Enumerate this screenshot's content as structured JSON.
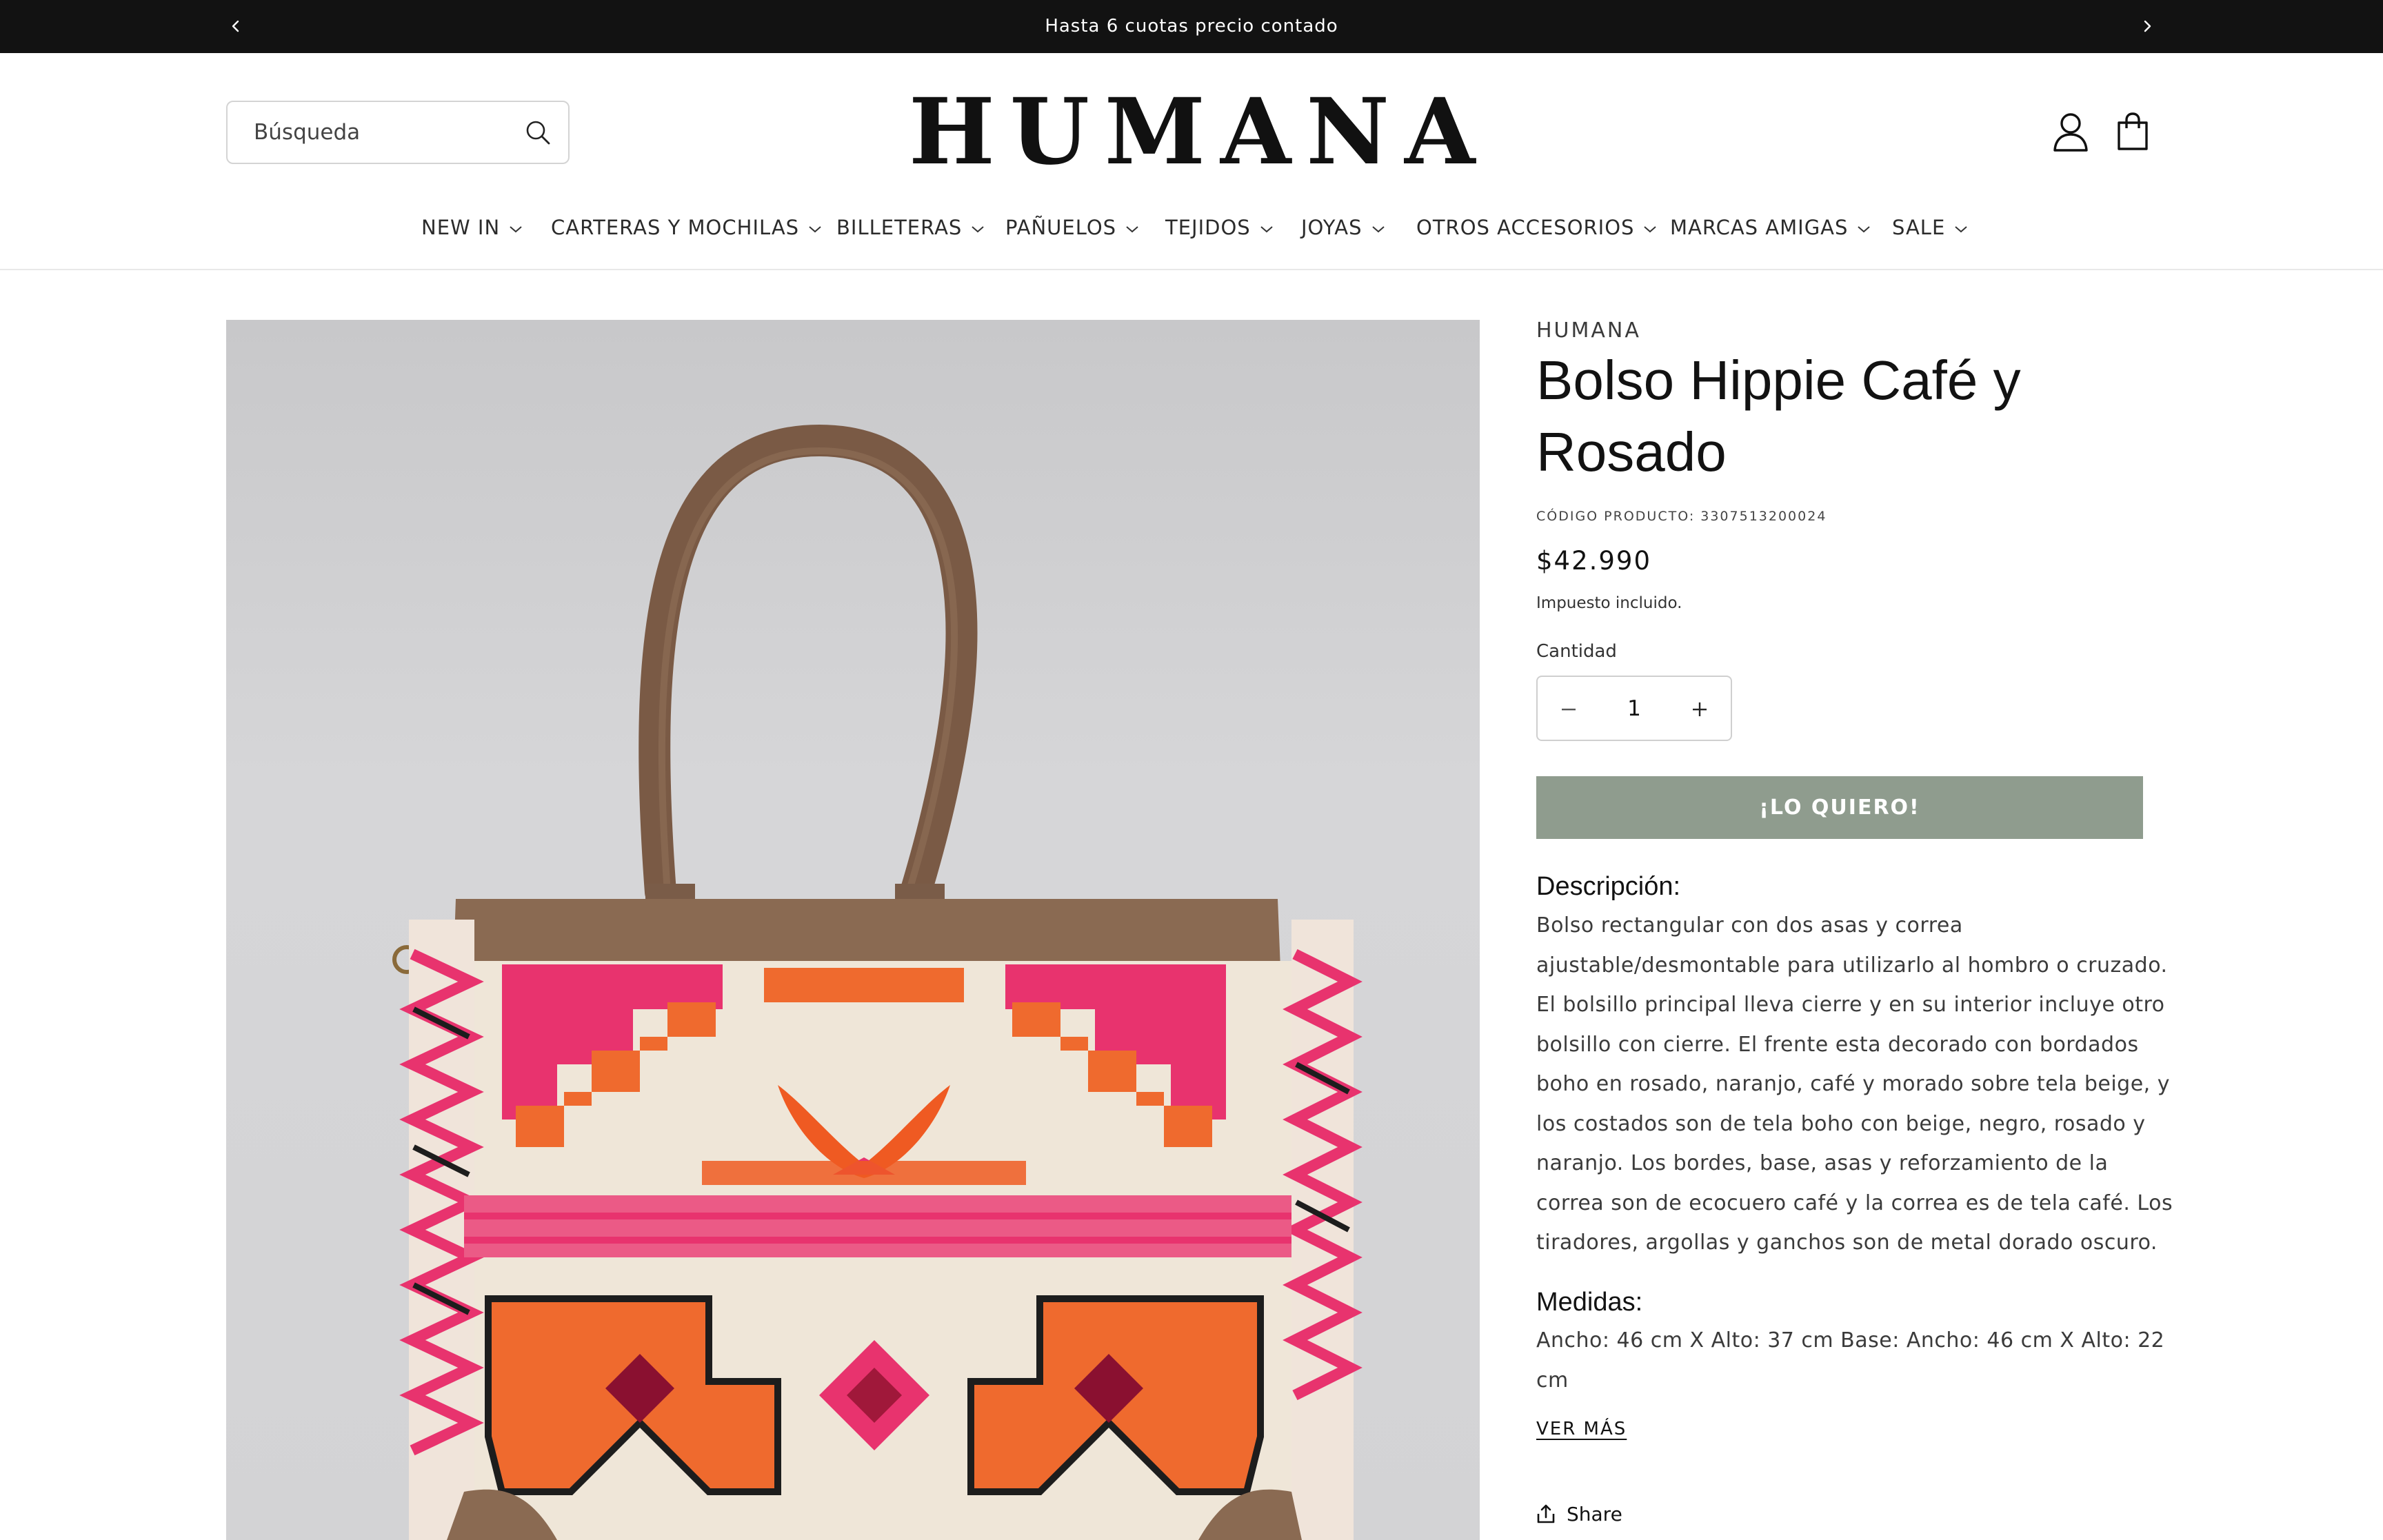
{
  "announcement": {
    "text": "Hasta 6 cuotas precio contado"
  },
  "header": {
    "search_placeholder": "Búsqueda",
    "logo": "HUMANA",
    "icons": [
      "account-icon",
      "cart-icon",
      "search-icon"
    ]
  },
  "nav": {
    "items": [
      {
        "label": "NEW IN"
      },
      {
        "label": "CARTERAS Y MOCHILAS"
      },
      {
        "label": "BILLETERAS"
      },
      {
        "label": "PAÑUELOS"
      },
      {
        "label": "TEJIDOS"
      },
      {
        "label": "JOYAS"
      },
      {
        "label": "OTROS ACCESORIOS"
      },
      {
        "label": "MARCAS AMIGAS"
      },
      {
        "label": "SALE"
      }
    ]
  },
  "product": {
    "vendor": "HUMANA",
    "title": "Bolso Hippie Café y Rosado",
    "sku": "CÓDIGO PRODUCTO: 3307513200024",
    "price": "$42.990",
    "tax_note": "Impuesto incluido.",
    "quantity_label": "Cantidad",
    "quantity_value": "1",
    "buy_label": "¡LO QUIERO!",
    "description_heading": "Descripción:",
    "description": "Bolso rectangular con dos asas y correa ajustable/desmontable para utilizarlo al hombro o cruzado. El bolsillo principal lleva cierre y en su interior incluye otro bolsillo con cierre. El frente esta decorado con bordados boho en rosado, naranjo, café y morado sobre tela beige, y los costados son de tela boho con beige, negro, rosado y naranjo. Los bordes, base, asas y reforzamiento de la correa son de ecocuero café y la correa es de tela café. Los tiradores, argollas y ganchos son de metal dorado oscuro.",
    "measures_heading": "Medidas:",
    "measures": "Ancho: 46 cm X Alto: 37 cm Base: Ancho: 46 cm X Alto: 22 cm",
    "see_more": "VER MÁS",
    "share": "Share"
  },
  "colors": {
    "announcement_bg": "#121212",
    "buy_button": "#8f9c8e",
    "bag_brown": "#8a6a52",
    "embroidery_pink": "#e8336e",
    "embroidery_orange": "#ef6a2e"
  }
}
